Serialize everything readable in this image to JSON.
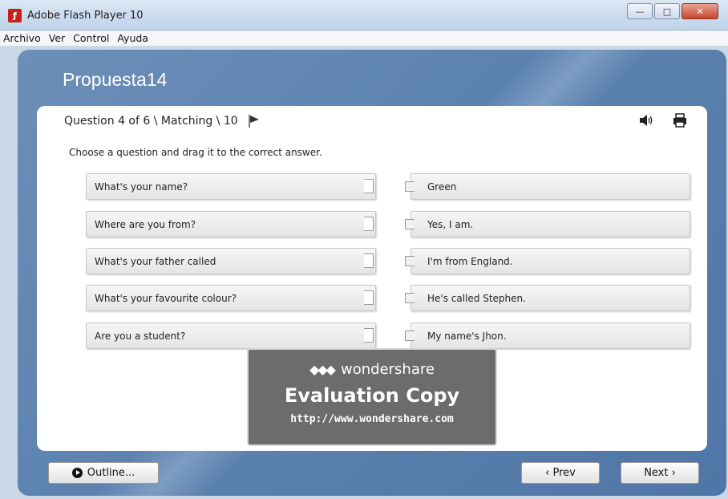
{
  "window": {
    "title": "Adobe Flash Player 10",
    "minimize": "—",
    "maximize": "□",
    "close": "✕"
  },
  "menu": [
    "Archivo",
    "Ver",
    "Control",
    "Ayuda"
  ],
  "presentation": {
    "title": "Propuesta14"
  },
  "question": {
    "header": "Question 4 of 6 \\ Matching \\ 10",
    "instruction": "Choose a question and drag it to the correct answer.",
    "questions": [
      "What's your name?",
      "Where are you from?",
      "What's your father called",
      "What's your favourite colour?",
      "Are you a student?"
    ],
    "answers": [
      "Green",
      "Yes, I am.",
      "I'm from England.",
      "He's called Stephen.",
      "My name's Jhon."
    ]
  },
  "watermark": {
    "brand": "wondershare",
    "title": "Evaluation Copy",
    "url": "http://www.wondershare.com"
  },
  "nav": {
    "outline": "Outline...",
    "prev": "‹ Prev",
    "next": "Next ›"
  },
  "icons": {
    "app": "flash-icon",
    "flag": "flag-icon",
    "audio": "speaker-icon",
    "print": "printer-icon",
    "outline": "play-circle-icon"
  },
  "colors": {
    "player_bg": "#5c82b0",
    "card_bg": "#ffffff",
    "watermark_bg": "#5f5f5f"
  }
}
